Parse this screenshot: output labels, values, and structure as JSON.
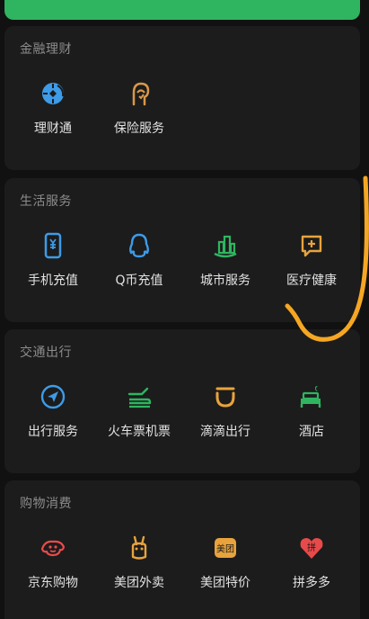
{
  "colors": {
    "background": "#111111",
    "card": "#1c1c1c",
    "title": "#8c8c8c",
    "label": "#e2e2e2",
    "top_bar_green": "#2fb560",
    "annotation_orange": "#f5a623"
  },
  "sections": [
    {
      "title": "金融理财",
      "items": [
        {
          "label": "理财通",
          "icon": "wealth-management-icon",
          "color": "#3d9be8"
        },
        {
          "label": "保险服务",
          "icon": "insurance-icon",
          "color": "#d9984a"
        }
      ]
    },
    {
      "title": "生活服务",
      "items": [
        {
          "label": "手机充值",
          "icon": "mobile-phone-icon",
          "color": "#3d9be8"
        },
        {
          "label": "Q币充值",
          "icon": "qq-penguin-icon",
          "color": "#3d9be8"
        },
        {
          "label": "城市服务",
          "icon": "city-buildings-icon",
          "color": "#2fb560"
        },
        {
          "label": "医疗健康",
          "icon": "medical-chat-icon",
          "color": "#e8a33d"
        }
      ]
    },
    {
      "title": "交通出行",
      "items": [
        {
          "label": "出行服务",
          "icon": "navigation-arrow-icon",
          "color": "#3d9be8"
        },
        {
          "label": "火车票机票",
          "icon": "train-plane-icon",
          "color": "#2fb560"
        },
        {
          "label": "滴滴出行",
          "icon": "didi-icon",
          "color": "#e8a33d"
        },
        {
          "label": "酒店",
          "icon": "hotel-bed-icon",
          "color": "#2fb560"
        }
      ]
    },
    {
      "title": "购物消费",
      "items": [
        {
          "label": "京东购物",
          "icon": "jd-dog-icon",
          "color": "#e84a4a"
        },
        {
          "label": "美团外卖",
          "icon": "meituan-kangaroo-icon",
          "color": "#e8a33d"
        },
        {
          "label": "美团特价",
          "icon": "meituan-badge-icon",
          "color": "#e8a33d",
          "badge_text": "美团"
        },
        {
          "label": "拼多多",
          "icon": "pinduoduo-icon",
          "color": "#e84a4a",
          "badge_text": "拼"
        }
      ]
    }
  ]
}
